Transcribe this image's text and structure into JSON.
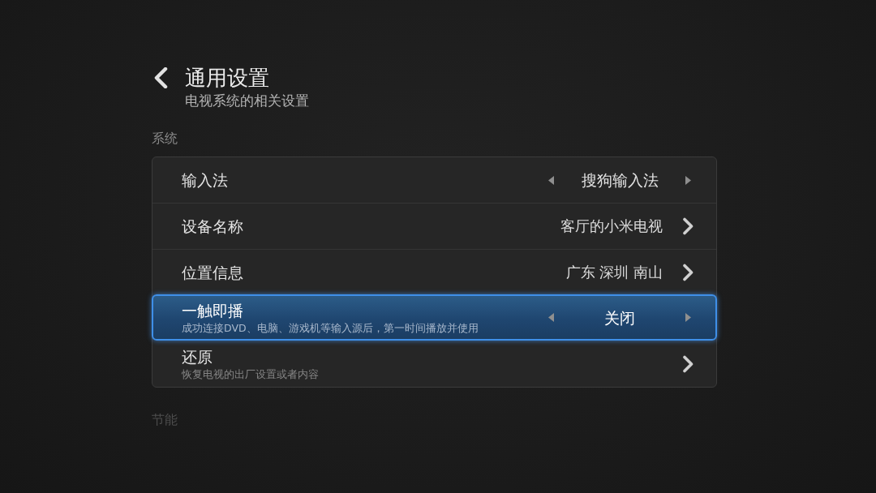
{
  "header": {
    "title": "通用设置",
    "subtitle": "电视系统的相关设置"
  },
  "sections": [
    {
      "title": "系统",
      "dimmed": false,
      "items": [
        {
          "kind": "selector",
          "label": "输入法",
          "value": "搜狗输入法",
          "selected": false
        },
        {
          "kind": "link",
          "label": "设备名称",
          "value": "客厅的小米电视",
          "selected": false
        },
        {
          "kind": "link",
          "label": "位置信息",
          "value": "广东 深圳 南山",
          "selected": false
        },
        {
          "kind": "selector",
          "label": "一触即播",
          "description": "成功连接DVD、电脑、游戏机等输入源后，第一时间播放并使用",
          "value": "关闭",
          "selected": true
        },
        {
          "kind": "link",
          "label": "还原",
          "description": "恢复电视的出厂设置或者内容",
          "selected": false
        }
      ]
    },
    {
      "title": "节能",
      "dimmed": true
    }
  ]
}
